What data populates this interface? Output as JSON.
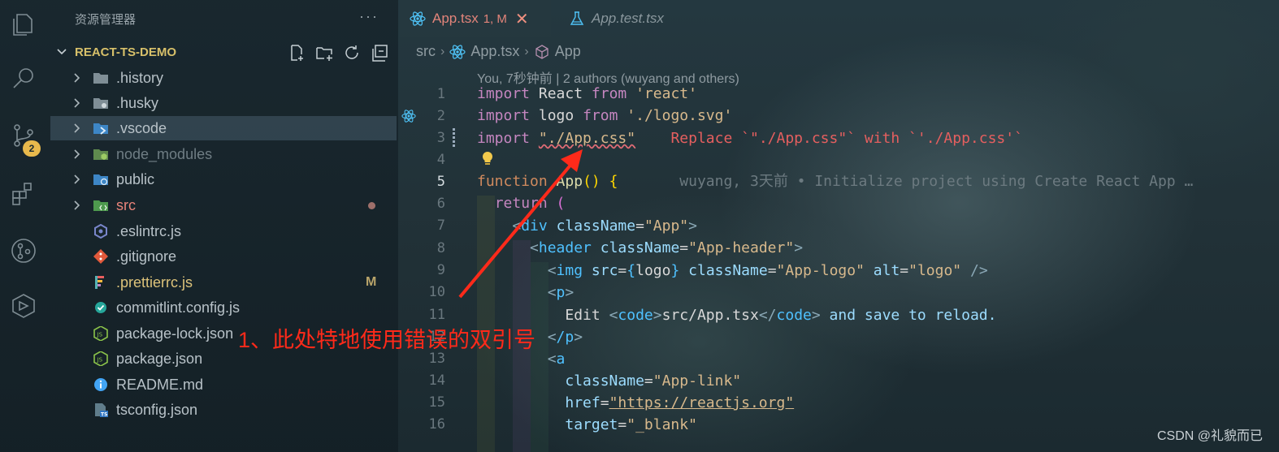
{
  "sidebar": {
    "title": "资源管理器",
    "more": "···",
    "project": "REACT-TS-DEMO",
    "scm_badge": "2",
    "items": [
      {
        "label": ".history",
        "icon": "folder-icon",
        "kind": "folder"
      },
      {
        "label": ".husky",
        "icon": "folder-husky-icon",
        "kind": "folder"
      },
      {
        "label": ".vscode",
        "icon": "folder-vscode-icon",
        "kind": "folder"
      },
      {
        "label": "node_modules",
        "icon": "folder-node-icon",
        "kind": "folder"
      },
      {
        "label": "public",
        "icon": "folder-public-icon",
        "kind": "folder"
      },
      {
        "label": "src",
        "icon": "folder-src-icon",
        "kind": "folder"
      },
      {
        "label": ".eslintrc.js",
        "icon": "eslint-icon",
        "kind": "file"
      },
      {
        "label": ".gitignore",
        "icon": "git-icon",
        "kind": "file"
      },
      {
        "label": ".prettierrc.js",
        "icon": "prettier-icon",
        "kind": "file",
        "mark": "M"
      },
      {
        "label": "commitlint.config.js",
        "icon": "commitlint-icon",
        "kind": "file"
      },
      {
        "label": "package-lock.json",
        "icon": "nodejs-icon",
        "kind": "file"
      },
      {
        "label": "package.json",
        "icon": "nodejs-icon",
        "kind": "file"
      },
      {
        "label": "README.md",
        "icon": "info-icon",
        "kind": "file"
      },
      {
        "label": "tsconfig.json",
        "icon": "typescript-icon",
        "kind": "file"
      }
    ]
  },
  "tabs": [
    {
      "label": "App.tsx",
      "status": "1, M",
      "close": "✕"
    },
    {
      "label": "App.test.tsx"
    }
  ],
  "breadcrumb": {
    "folder": "src",
    "file": "App.tsx",
    "symbol": "App"
  },
  "blame": "You, 7秒钟前 | 2 authors (wuyang and others)",
  "code": {
    "l1_kw": "import",
    "l1_id": " React ",
    "l1_from": "from",
    "l1_str": "'react'",
    "l2_kw": "import",
    "l2_id": " logo ",
    "l2_from": "from",
    "l2_str": "'./logo.svg'",
    "l3_kw": "import",
    "l3_str": "\"./App.css\"",
    "l3_lint": "Replace `\"./App.css\"` with `'./App.css'`",
    "l5_kw": "function",
    "l5_fn": " App",
    "l5_rest": "() {",
    "l5_ghost": "wuyang, 3天前 • Initialize project using Create React App …",
    "l6_kw": "return",
    "l6_paren": " (",
    "l7_tag": "div",
    "l7_attr": "className",
    "l7_str": "\"App\"",
    "l8_tag": "header",
    "l8_attr": "className",
    "l8_str": "\"App-header\"",
    "l9_tag": "img",
    "l9_attr1": "src",
    "l9_val": "logo",
    "l9_attr2": "className",
    "l9_str2": "\"App-logo\"",
    "l9_attr3": "alt",
    "l9_str3": "\"logo\"",
    "l10_tag": "p",
    "l11_pre": "Edit ",
    "l11_code": "code",
    "l11_path": "src/App.tsx",
    "l11_post": " and save to reload.",
    "l12_tag": "/p",
    "l13_tag": "a",
    "l14_attr": "className",
    "l14_str": "\"App-link\"",
    "l15_attr": "href",
    "l15_str": "\"https://reactjs.org\"",
    "l16_attr": "target",
    "l16_str": "\"_blank\""
  },
  "line_numbers": [
    "1",
    "2",
    "3",
    "4",
    "5",
    "6",
    "7",
    "8",
    "9",
    "10",
    "11",
    "12",
    "13",
    "14",
    "15",
    "16"
  ],
  "annotation": "1、此处特地使用错误的双引号",
  "watermark": "CSDN @礼貌而已"
}
